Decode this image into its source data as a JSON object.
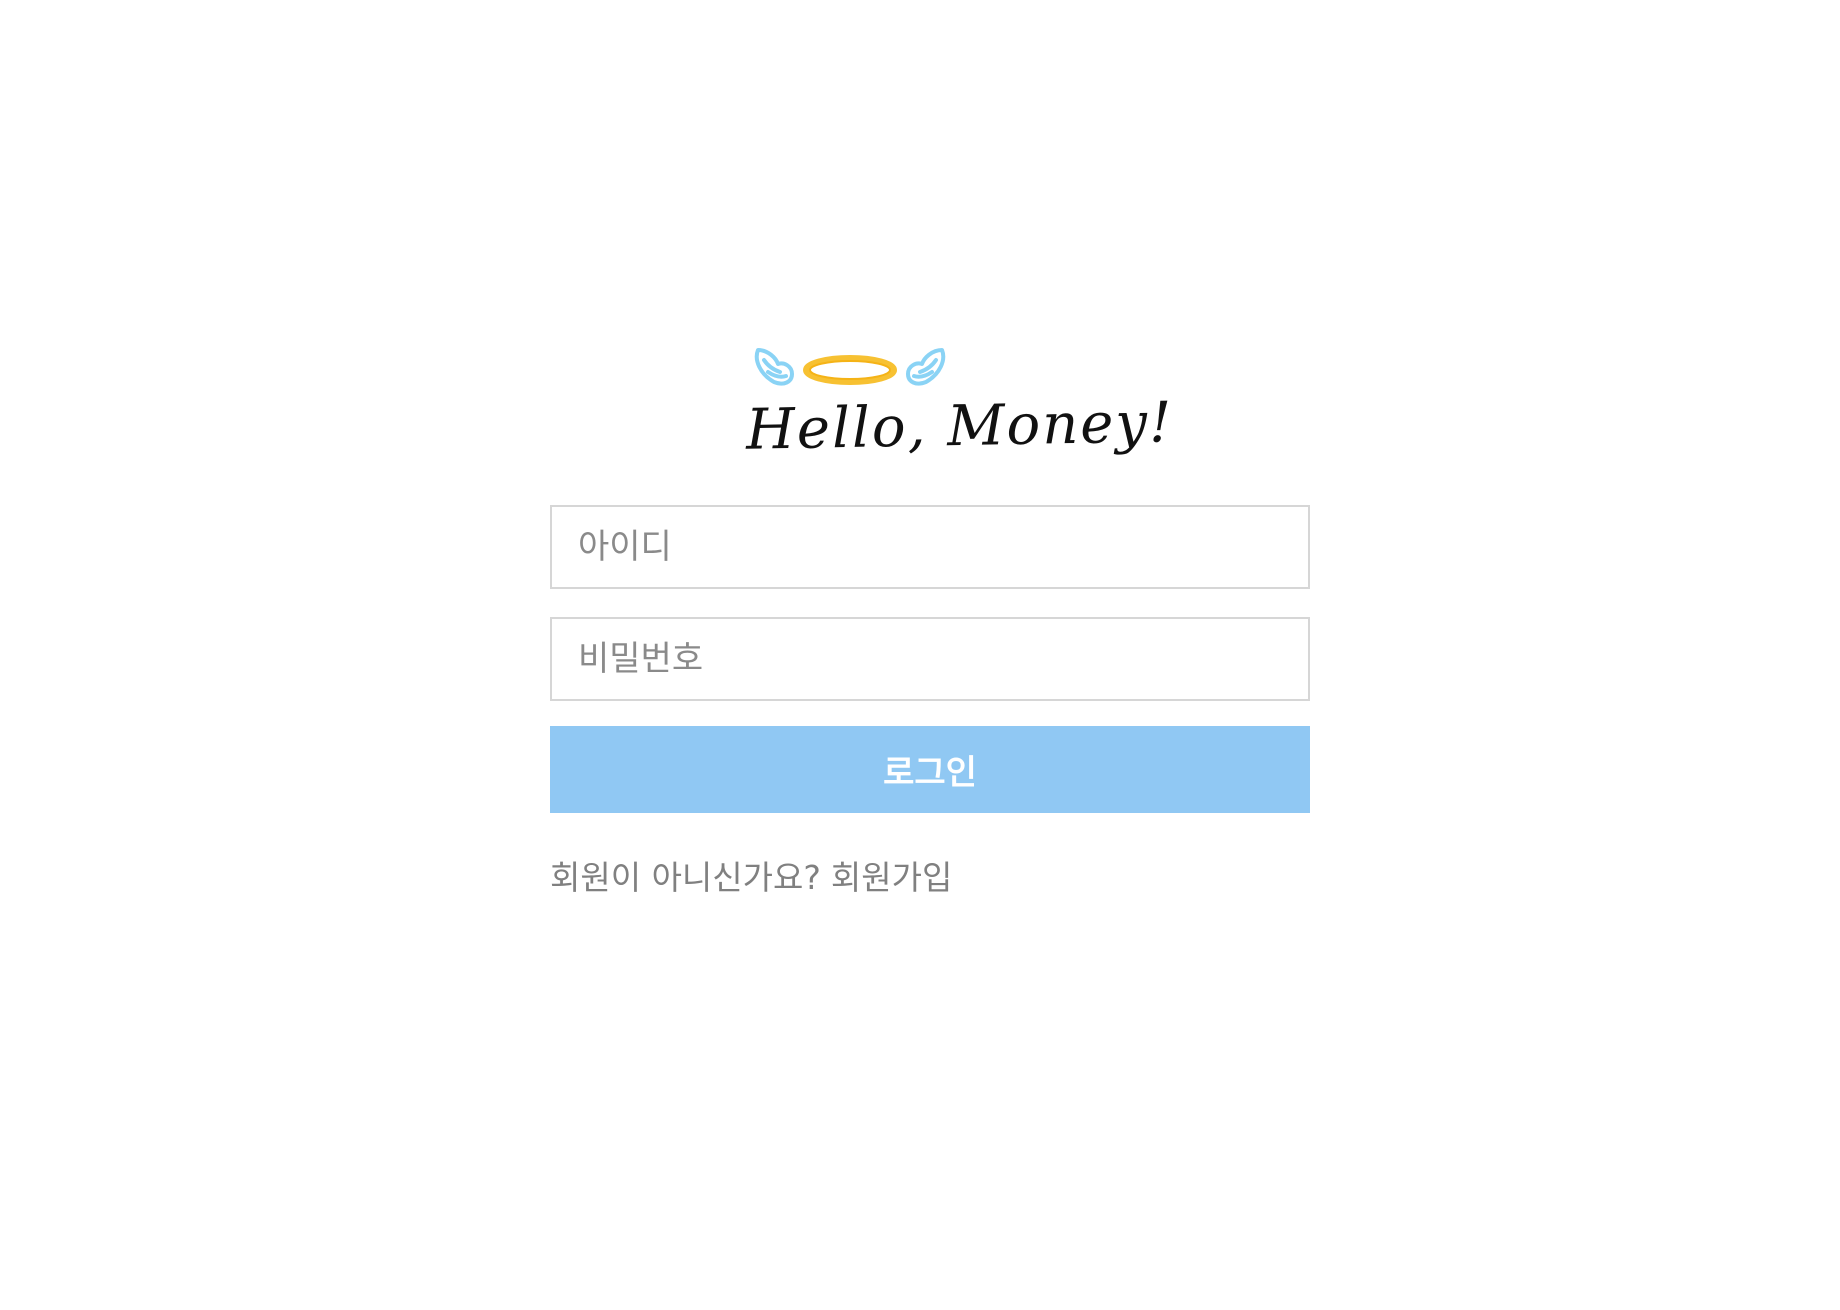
{
  "logo": {
    "text": "Hello, Money!",
    "icon": "halo-wings-icon",
    "colors": {
      "wings": "#8ad3f5",
      "halo": "#f7c132",
      "text": "#111111"
    }
  },
  "form": {
    "id_placeholder": "아이디",
    "id_value": "",
    "password_placeholder": "비밀번호",
    "password_value": "",
    "login_label": "로그인",
    "button_color": "#90c8f3"
  },
  "signup": {
    "prompt": "회원이 아니신가요?",
    "link_label": "회원가입"
  }
}
